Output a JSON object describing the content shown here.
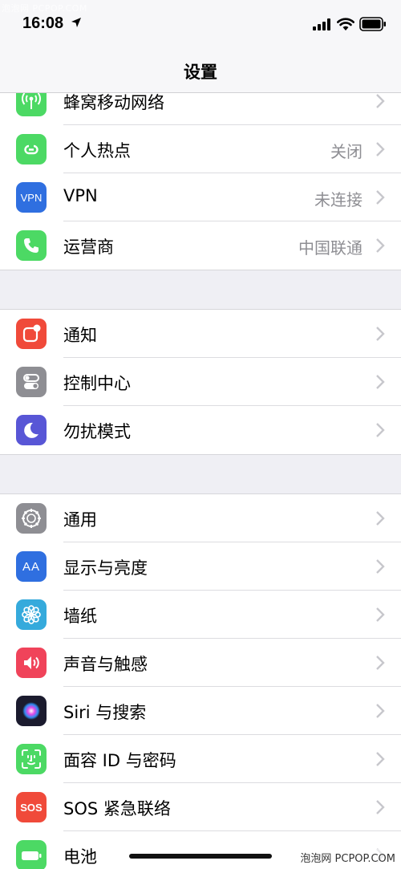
{
  "watermark": {
    "top": "泡泡网 PCPOP.COM",
    "bottom": "泡泡网 PCPOP.COM"
  },
  "status_bar": {
    "time": "16:08"
  },
  "nav": {
    "title": "设置"
  },
  "groups": [
    {
      "items": [
        {
          "label": "蜂窝移动网络",
          "value": "",
          "icon": "antenna-icon",
          "color": "#4cd964"
        },
        {
          "label": "个人热点",
          "value": "关闭",
          "icon": "hotspot-icon",
          "color": "#4cd964"
        },
        {
          "label": "VPN",
          "value": "未连接",
          "icon": "vpn-icon",
          "color": "#2f6fe0",
          "icon_text": "VPN"
        },
        {
          "label": "运营商",
          "value": "中国联通",
          "icon": "phone-icon",
          "color": "#4cd964"
        }
      ]
    },
    {
      "items": [
        {
          "label": "通知",
          "value": "",
          "icon": "notification-icon",
          "color": "#f04a3a"
        },
        {
          "label": "控制中心",
          "value": "",
          "icon": "control-center-icon",
          "color": "#8e8e93"
        },
        {
          "label": "勿扰模式",
          "value": "",
          "icon": "moon-icon",
          "color": "#5856d6"
        }
      ]
    },
    {
      "items": [
        {
          "label": "通用",
          "value": "",
          "icon": "gear-icon",
          "color": "#8e8e93"
        },
        {
          "label": "显示与亮度",
          "value": "",
          "icon": "display-brightness-icon",
          "color": "#2f6fe0",
          "icon_text": "AA"
        },
        {
          "label": "墙纸",
          "value": "",
          "icon": "wallpaper-flower-icon",
          "color": "#35aadc"
        },
        {
          "label": "声音与触感",
          "value": "",
          "icon": "speaker-icon",
          "color": "#f0435a"
        },
        {
          "label": "Siri 与搜索",
          "value": "",
          "icon": "siri-icon",
          "color": "#1b1b2e"
        },
        {
          "label": "面容 ID 与密码",
          "value": "",
          "icon": "face-id-icon",
          "color": "#4cd964"
        },
        {
          "label": "SOS 紧急联络",
          "value": "",
          "icon": "sos-icon",
          "color": "#f04a3a",
          "icon_text": "SOS"
        },
        {
          "label": "电池",
          "value": "",
          "icon": "battery-settings-icon",
          "color": "#4cd964"
        }
      ]
    }
  ]
}
